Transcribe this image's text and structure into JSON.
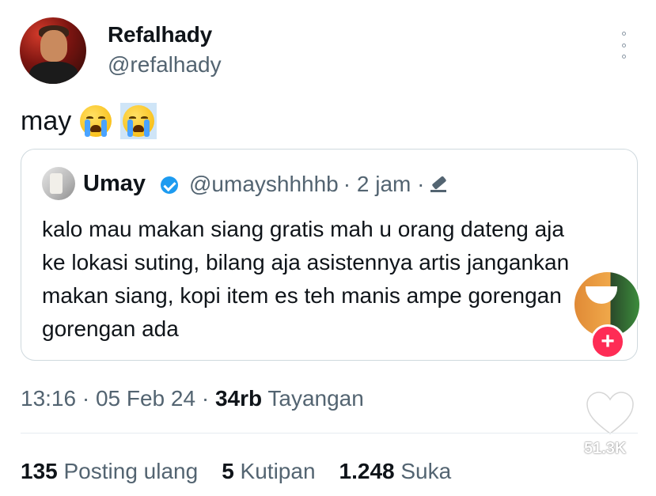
{
  "author": {
    "name": "Refalhady",
    "handle": "@refalhady"
  },
  "tweet": {
    "text": "may",
    "emojis": [
      "loudly-crying-face",
      "loudly-crying-face"
    ]
  },
  "quoted": {
    "name": "Umay",
    "handle": "@umayshhhhb",
    "time": "· 2 jam ·",
    "text": "kalo mau makan siang gratis mah u orang dateng aja ke lokasi suting, bilang aja asistennya artis jangankan makan siang, kopi item es teh manis ampe gorengan gorengan ada"
  },
  "meta": {
    "time": "13:16 · 05 Feb 24 · ",
    "views": "34rb",
    "views_label": " Tayangan"
  },
  "stats": {
    "reposts": "135",
    "reposts_label": " Posting ulang",
    "quotes": "5",
    "quotes_label": " Kutipan",
    "likes": "1.248",
    "likes_label": " Suka"
  },
  "overlay": {
    "plus_label": "+",
    "like_count": "51.3K"
  },
  "colors": {
    "verified": "#1d9bf0",
    "muted": "#536471",
    "plus": "#fe2c55"
  }
}
